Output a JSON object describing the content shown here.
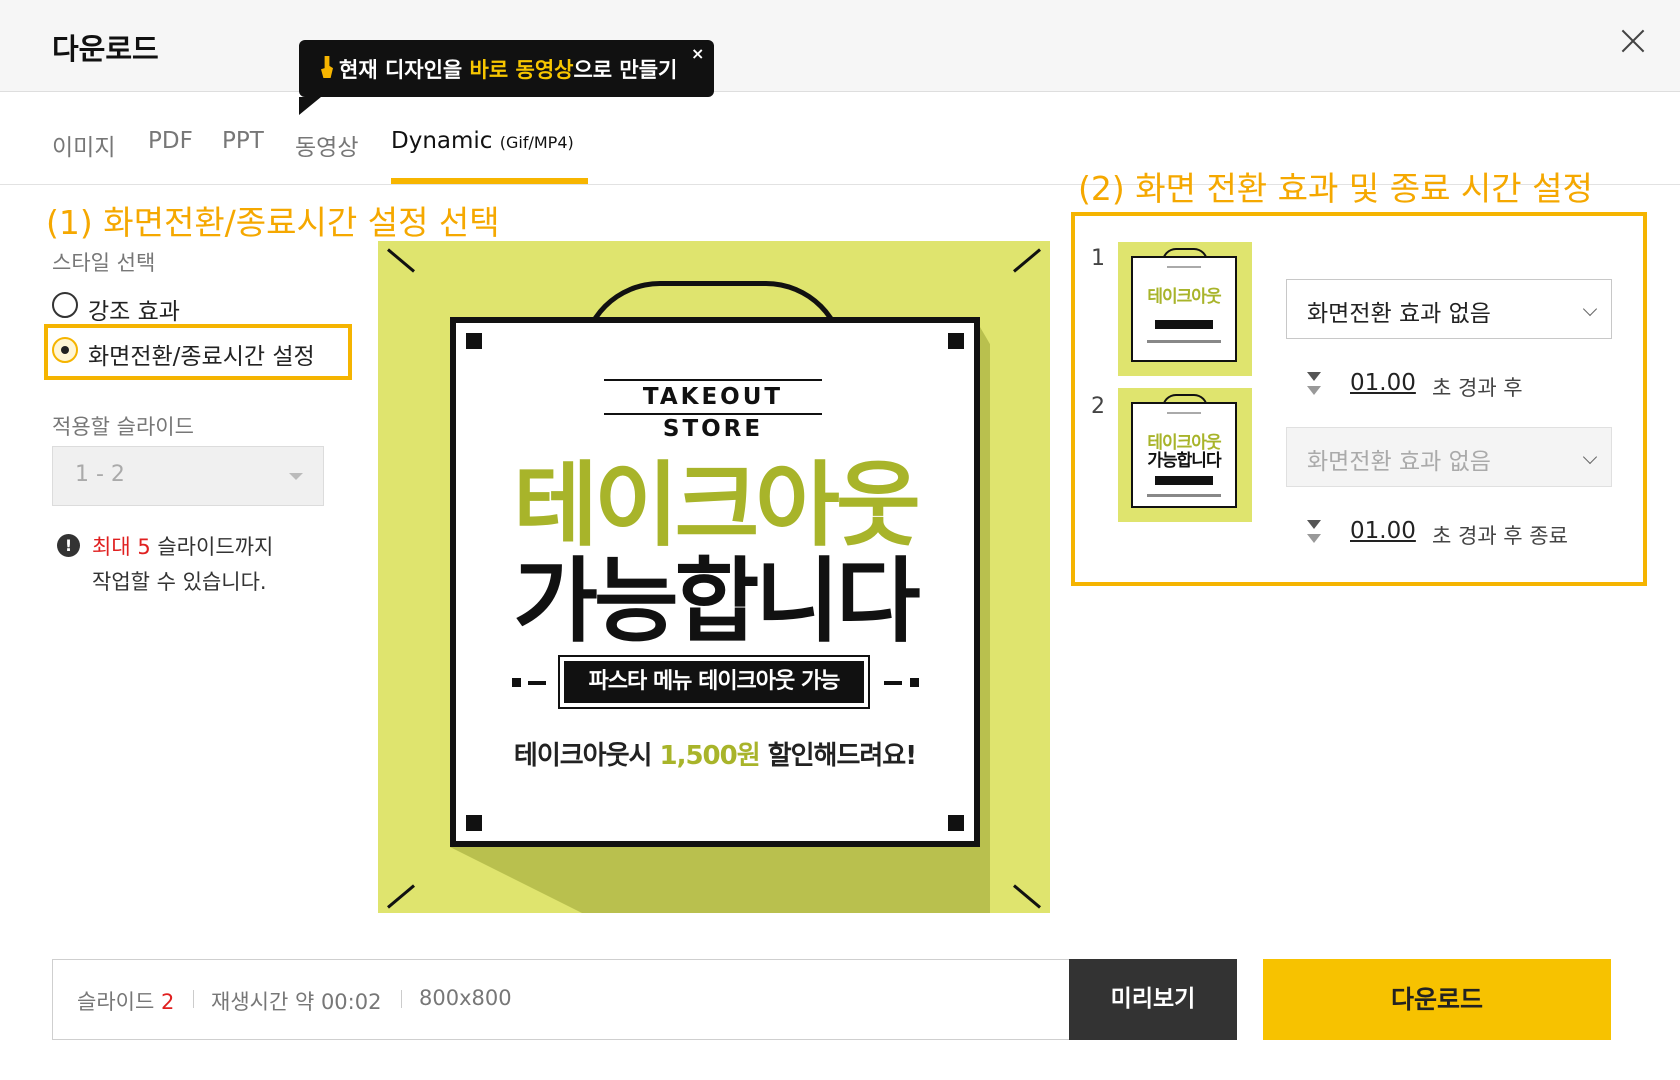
{
  "header": {
    "title": "다운로드"
  },
  "tooltip": {
    "pre": "현재 디자인을 ",
    "hl1": "바로 동영상",
    "post": "으로 만들기",
    "close": "×"
  },
  "tabs": [
    {
      "label": "이미지"
    },
    {
      "label": "PDF"
    },
    {
      "label": "PPT"
    },
    {
      "label": "동영상"
    },
    {
      "label": "Dynamic",
      "sub": "(Gif/MP4)"
    }
  ],
  "annotations": {
    "left": "(1) 화면전환/종료시간 설정 선택",
    "right": "(2) 화면 전환 효과 및 종료 시간 설정"
  },
  "style_section": {
    "label": "스타일 선택",
    "options": [
      {
        "label": "강조 효과",
        "selected": false
      },
      {
        "label": "화면전환/종료시간 설정",
        "selected": true
      }
    ]
  },
  "slide_section": {
    "label": "적용할 슬라이드",
    "value": "1 - 2"
  },
  "notice": {
    "prefix": "최대 5",
    "line1_rest": " 슬라이드까지",
    "line2": "작업할 수 있습니다.",
    "icon": "exclamation-icon"
  },
  "preview": {
    "store": "TAKEOUT STORE",
    "headline1": "테이크아웃",
    "headline2": "가능합니다",
    "menu": "파스타 메뉴 테이크아웃 가능",
    "promo_pre": "테이크아웃시 ",
    "promo_price": "1,500원",
    "promo_post": " 할인해드려요!",
    "bg_color": "#dfe46e",
    "accent_color": "#a8b42a"
  },
  "slides": [
    {
      "number": "1",
      "transition": "화면전환 효과 없음",
      "time": "01.00",
      "time_suffix": "초 경과 후"
    },
    {
      "number": "2",
      "transition": "화면전환 효과 없음",
      "time": "01.00",
      "time_suffix": "초 경과 후 종료"
    }
  ],
  "thumb": {
    "line1": "테이크아웃",
    "line2": "가능합니다"
  },
  "infobar": {
    "slides_label": "슬라이드",
    "slides_count": "2",
    "duration": "재생시간 약 00:02",
    "size": "800x800"
  },
  "buttons": {
    "preview": "미리보기",
    "download": "다운로드"
  },
  "colors": {
    "accent": "#f7c200",
    "annotation": "#f5a800"
  }
}
